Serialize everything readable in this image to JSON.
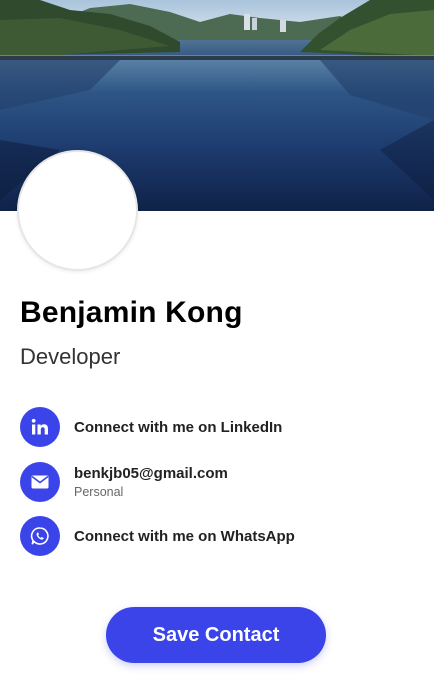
{
  "profile": {
    "name": "Benjamin Kong",
    "title": "Developer"
  },
  "contacts": [
    {
      "icon": "linkedin-icon",
      "label": "Connect with me on LinkedIn"
    },
    {
      "icon": "email-icon",
      "label": "benkjb05@gmail.com",
      "sublabel": "Personal"
    },
    {
      "icon": "whatsapp-icon",
      "label": "Connect with me on WhatsApp"
    }
  ],
  "actions": {
    "save_label": "Save Contact"
  },
  "colors": {
    "accent": "#3a44e8"
  }
}
